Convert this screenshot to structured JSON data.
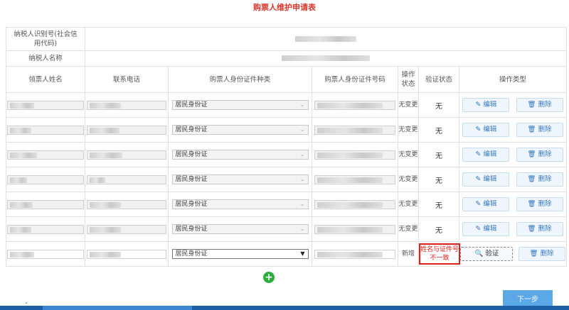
{
  "title": "购票人维护申请表",
  "taxpayer": {
    "id_label": "纳税人识别号(社会信用代码)",
    "name_label": "纳税人名称"
  },
  "columns": {
    "name": "领票人姓名",
    "phone": "联系电话",
    "id_type": "购票人身份证件种类",
    "id_number": "购票人身份证件号码",
    "op_status": "操作状态",
    "verify_status": "验证状态",
    "op_type": "操作类型"
  },
  "rows": [
    {
      "id_type": "居民身份证",
      "op_status": "无变更",
      "verify": "无"
    },
    {
      "id_type": "居民身份证",
      "op_status": "无变更",
      "verify": "无"
    },
    {
      "id_type": "居民身份证",
      "op_status": "无变更",
      "verify": "无"
    },
    {
      "id_type": "居民身份证",
      "op_status": "无变更",
      "verify": "无"
    },
    {
      "id_type": "居民身份证",
      "op_status": "无变更",
      "verify": "无"
    },
    {
      "id_type": "居民身份证",
      "op_status": "无变更",
      "verify": "无"
    },
    {
      "id_type": "居民身份证",
      "op_status": "新增",
      "verify": "姓名与证件号不一致"
    }
  ],
  "actions": {
    "edit": "编辑",
    "delete": "删除",
    "verify": "验证"
  },
  "icons": {
    "edit": "edit-icon",
    "delete": "trash-icon",
    "verify": "document-search-icon",
    "add": "plus-circle-icon",
    "select": "chevron-down-icon"
  },
  "add_button": "+",
  "next_button": "下一步",
  "colors": {
    "title": "#d7372d",
    "error": "#e0201a",
    "add": "#2cae3a",
    "next": "#5aa9e6",
    "link": "#3a7abf"
  }
}
